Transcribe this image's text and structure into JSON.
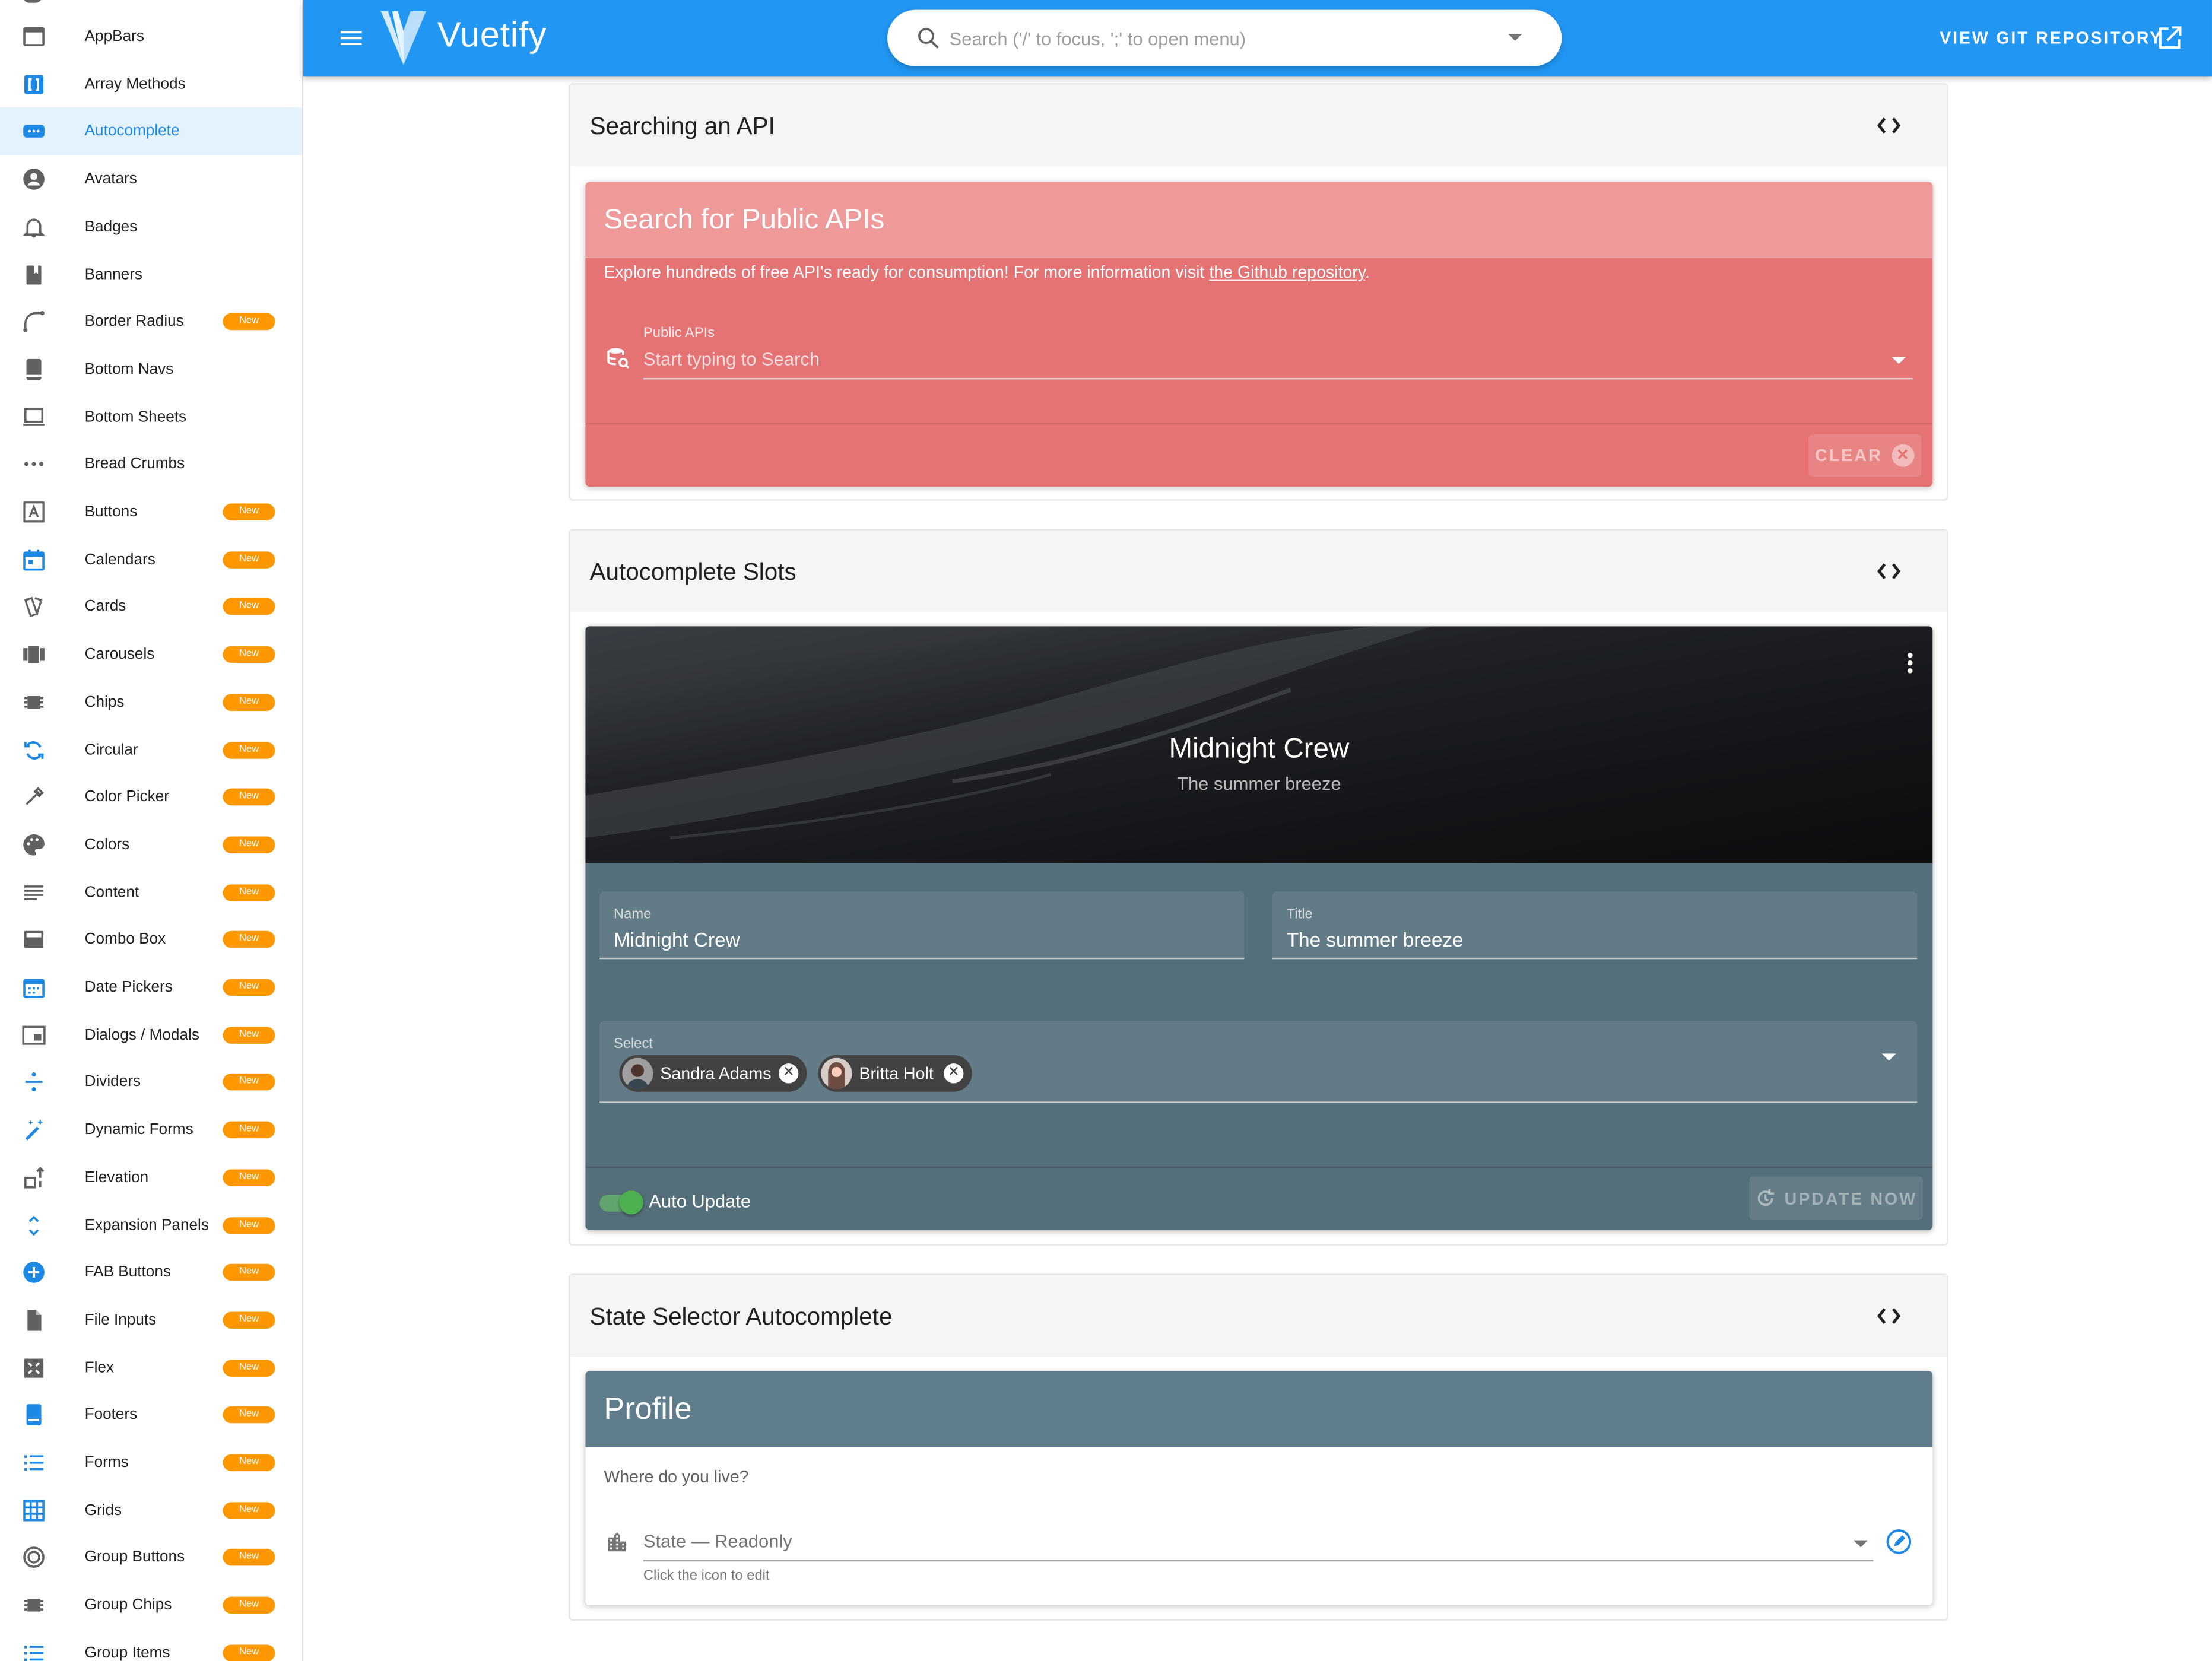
{
  "sidebar": {
    "items": [
      {
        "label": "AppBars",
        "icon": "web-asset-icon",
        "badge": ""
      },
      {
        "label": "Array Methods",
        "icon": "code-brackets-icon",
        "badge": ""
      },
      {
        "label": "Autocomplete",
        "icon": "form-textbox-icon",
        "badge": "",
        "active": true
      },
      {
        "label": "Avatars",
        "icon": "account-circle-icon",
        "badge": ""
      },
      {
        "label": "Badges",
        "icon": "bell-icon",
        "badge": ""
      },
      {
        "label": "Banners",
        "icon": "bookmark-icon",
        "badge": ""
      },
      {
        "label": "Border Radius",
        "icon": "vector-radius-icon",
        "badge": "New"
      },
      {
        "label": "Bottom Navs",
        "icon": "tablet-icon",
        "badge": ""
      },
      {
        "label": "Bottom Sheets",
        "icon": "laptop-icon",
        "badge": ""
      },
      {
        "label": "Bread Crumbs",
        "icon": "dots-horizontal-icon",
        "badge": ""
      },
      {
        "label": "Buttons",
        "icon": "alpha-a-box-icon",
        "badge": "New"
      },
      {
        "label": "Calendars",
        "icon": "calendar-icon",
        "badge": "New"
      },
      {
        "label": "Cards",
        "icon": "cards-icon",
        "badge": "New"
      },
      {
        "label": "Carousels",
        "icon": "view-carousel-icon",
        "badge": "New"
      },
      {
        "label": "Chips",
        "icon": "chip-icon",
        "badge": "New"
      },
      {
        "label": "Circular",
        "icon": "sync-icon",
        "badge": "New"
      },
      {
        "label": "Color Picker",
        "icon": "eyedropper-icon",
        "badge": "New"
      },
      {
        "label": "Colors",
        "icon": "palette-icon",
        "badge": "New"
      },
      {
        "label": "Content",
        "icon": "text-lines-icon",
        "badge": "New"
      },
      {
        "label": "Combo Box",
        "icon": "combo-box-icon",
        "badge": "New"
      },
      {
        "label": "Date Pickers",
        "icon": "calendar-range-icon",
        "badge": "New"
      },
      {
        "label": "Dialogs / Modals",
        "icon": "picture-in-picture-icon",
        "badge": "New"
      },
      {
        "label": "Dividers",
        "icon": "division-icon",
        "badge": "New"
      },
      {
        "label": "Dynamic Forms",
        "icon": "auto-fix-icon",
        "badge": "New"
      },
      {
        "label": "Elevation",
        "icon": "elevation-icon",
        "badge": "New"
      },
      {
        "label": "Expansion Panels",
        "icon": "unfold-icon",
        "badge": "New"
      },
      {
        "label": "FAB Buttons",
        "icon": "plus-circle-icon",
        "badge": "New"
      },
      {
        "label": "File Inputs",
        "icon": "file-icon",
        "badge": "New"
      },
      {
        "label": "Flex",
        "icon": "flex-icon",
        "badge": "New"
      },
      {
        "label": "Footers",
        "icon": "footer-icon",
        "badge": "New"
      },
      {
        "label": "Forms",
        "icon": "format-list-icon",
        "badge": "New"
      },
      {
        "label": "Grids",
        "icon": "grid-icon",
        "badge": "New"
      },
      {
        "label": "Group Buttons",
        "icon": "circle-double-icon",
        "badge": "New"
      },
      {
        "label": "Group Chips",
        "icon": "chip-icon",
        "badge": "New"
      },
      {
        "label": "Group Items",
        "icon": "format-list-icon",
        "badge": "New"
      }
    ]
  },
  "header": {
    "brand": "Vuetify",
    "search_placeholder": "Search ('/' to focus, ';' to open menu)",
    "git_label": "VIEW GIT REPOSITORY"
  },
  "api_section": {
    "title": "Searching an API",
    "card_title": "Search for Public APIs",
    "desc_text": "Explore hundreds of free API's ready for consumption! For more information visit ",
    "desc_link": "the Github repository",
    "desc_end": ".",
    "field_label": "Public APIs",
    "field_placeholder": "Start typing to Search",
    "clear_label": "CLEAR"
  },
  "slots_section": {
    "title": "Autocomplete Slots",
    "hero_name": "Midnight Crew",
    "hero_sub": "The summer breeze",
    "name_label": "Name",
    "name_value": "Midnight Crew",
    "title_label": "Title",
    "title_value": "The summer breeze",
    "select_label": "Select",
    "chips": [
      "Sandra Adams",
      "Britta Holt"
    ],
    "switch_label": "Auto Update",
    "switch_on": true,
    "update_label": "UPDATE NOW"
  },
  "state_section": {
    "title": "State Selector Autocomplete",
    "card_title": "Profile",
    "question": "Where do you live?",
    "field_value": "State — Readonly",
    "hint": "Click the icon to edit"
  },
  "colors": {
    "primary": "#2196f3",
    "api_card": "#e57373",
    "api_header": "#ef9a9a",
    "slate": "#546e7a",
    "badge": "#ff9800"
  }
}
